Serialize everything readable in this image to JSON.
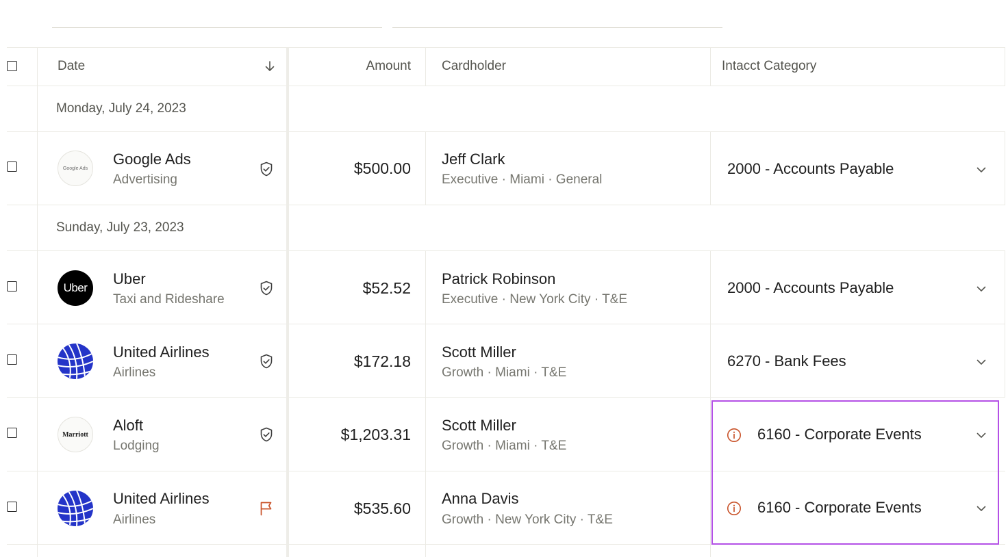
{
  "table": {
    "columns": {
      "date": "Date",
      "amount": "Amount",
      "cardholder": "Cardholder",
      "category": "Intacct Category"
    },
    "groups": [
      {
        "label": "Monday, July 24, 2023"
      },
      {
        "label": "Sunday, July 23, 2023"
      }
    ],
    "rows": [
      {
        "merchant": "Google Ads",
        "merchant_category": "Advertising",
        "logo_text": "Google Ads",
        "status_icon": "shield-check-icon",
        "amount": "$500.00",
        "cardholder": "Jeff Clark",
        "cardholder_meta": "Executive · Miami · General",
        "category": "2000 - Accounts Payable",
        "warning": false
      },
      {
        "merchant": "Uber",
        "merchant_category": "Taxi and Rideshare",
        "logo_text": "Uber",
        "status_icon": "shield-check-icon",
        "amount": "$52.52",
        "cardholder": "Patrick Robinson",
        "cardholder_meta": "Executive · New York City · T&E",
        "category": "2000 - Accounts Payable",
        "warning": false
      },
      {
        "merchant": "United Airlines",
        "merchant_category": "Airlines",
        "logo_text": "",
        "status_icon": "shield-check-icon",
        "amount": "$172.18",
        "cardholder": "Scott Miller",
        "cardholder_meta": "Growth · Miami · T&E",
        "category": "6270 - Bank Fees",
        "warning": false
      },
      {
        "merchant": "Aloft",
        "merchant_category": "Lodging",
        "logo_text": "Marriott",
        "status_icon": "shield-check-icon",
        "amount": "$1,203.31",
        "cardholder": "Scott Miller",
        "cardholder_meta": "Growth · Miami · T&E",
        "category": "6160 - Corporate Events",
        "warning": true
      },
      {
        "merchant": "United Airlines",
        "merchant_category": "Airlines",
        "logo_text": "",
        "status_icon": "flag-icon",
        "amount": "$535.60",
        "cardholder": "Anna Davis",
        "cardholder_meta": "Growth · New York City · T&E",
        "category": "6160 - Corporate Events",
        "warning": true
      }
    ]
  },
  "colors": {
    "highlight_border": "#b451e6",
    "warning": "#c9532a",
    "flag": "#c9532a"
  }
}
